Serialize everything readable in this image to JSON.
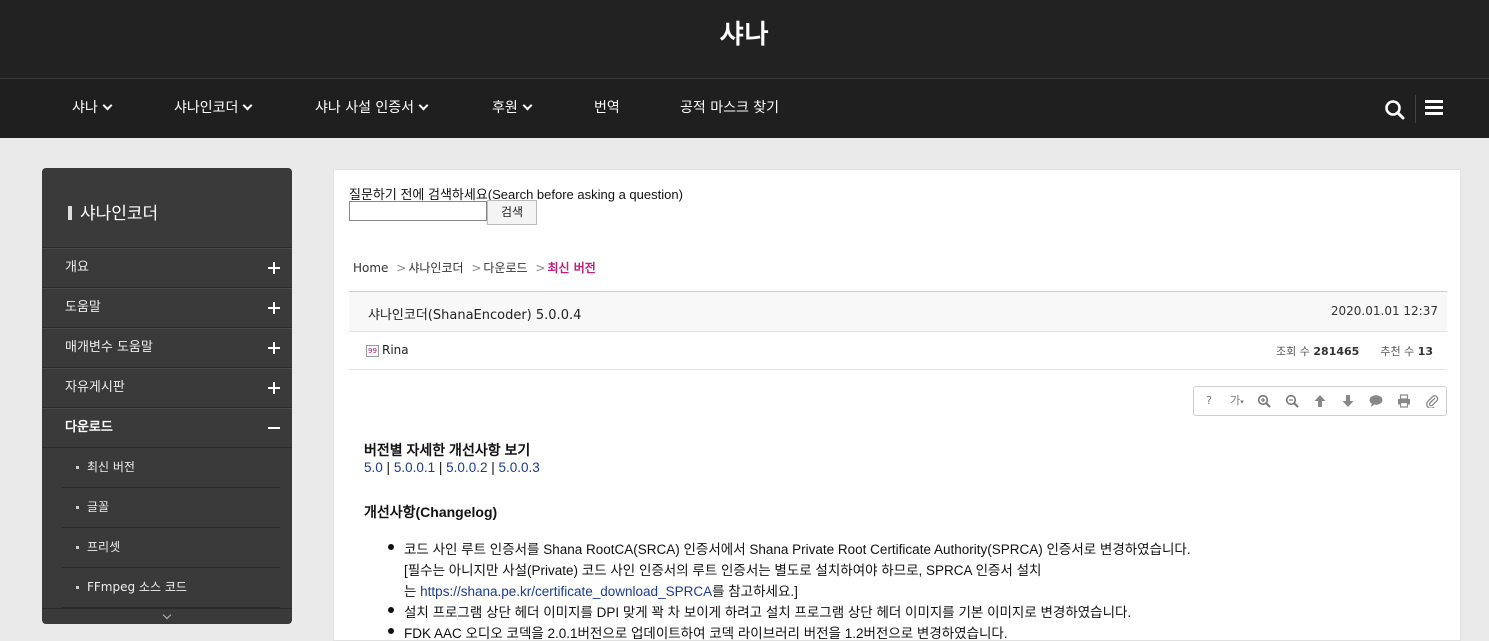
{
  "header": {
    "site_title": "샤나"
  },
  "nav": {
    "items": [
      {
        "label": "샤나",
        "dropdown": true
      },
      {
        "label": "샤나인코더",
        "dropdown": true
      },
      {
        "label": "샤나 사설 인증서",
        "dropdown": true
      },
      {
        "label": "후원",
        "dropdown": true
      },
      {
        "label": "번역",
        "dropdown": false
      },
      {
        "label": "공적 마스크 찾기",
        "dropdown": false
      }
    ],
    "search_icon": "search-icon",
    "menu_icon": "hamburger-menu-icon"
  },
  "sidebar": {
    "title": "샤나인코더",
    "items": [
      {
        "label": "개요",
        "expand": "plus"
      },
      {
        "label": "도움말",
        "expand": "plus"
      },
      {
        "label": "매개변수 도움말",
        "expand": "plus"
      },
      {
        "label": "자유게시판",
        "expand": "plus"
      },
      {
        "label": "다운로드",
        "expand": "minus",
        "active": true
      }
    ],
    "subitems": [
      {
        "label": "최신 버전"
      },
      {
        "label": "글꼴"
      },
      {
        "label": "프리셋"
      },
      {
        "label": "FFmpeg 소스 코드"
      }
    ]
  },
  "search": {
    "label": "질문하기 전에 검색하세요(Search before asking a question)",
    "value": "",
    "button": "검색"
  },
  "breadcrumb": {
    "items": [
      "Home",
      "샤나인코더",
      "다운로드"
    ],
    "current": "최신 버전"
  },
  "post": {
    "title": "샤나인코더(ShanaEncoder) 5.0.0.4",
    "date": "2020.01.01 12:37",
    "author": "Rina",
    "views_label": "조회 수",
    "views": "281465",
    "votes_label": "추천 수",
    "votes": "13"
  },
  "toolbar": {
    "icons": [
      "help-icon",
      "font-size-icon",
      "zoom-in-icon",
      "zoom-out-icon",
      "arrow-up-icon",
      "arrow-down-icon",
      "comment-icon",
      "print-icon",
      "attachment-icon"
    ],
    "help_label": "?",
    "font_label": "가"
  },
  "content": {
    "versions_heading": "버전별 자세한 개선사항 보기",
    "version_links": [
      "5.0",
      "5.0.0.1",
      "5.0.0.2",
      "5.0.0.3"
    ],
    "changelog_heading": "개선사항(Changelog)",
    "changelog": [
      {
        "lines": [
          "코드 사인 루트 인증서를 Shana RootCA(SRCA) 인증서에서 Shana Private Root Certificate Authority(SPRCA) 인증서로 변경하였습니다.",
          "[필수는 아니지만 사설(Private) 코드 사인 인증서의 루트 인증서는 별도로 설치하여야 하므로, SPRCA 인증서 설치"
        ],
        "line3_prefix": "는 ",
        "line3_link": "https://shana.pe.kr/certificate_download_SPRCA",
        "line3_suffix": "를 참고하세요.]"
      },
      {
        "text": "설치 프로그램 상단 헤더 이미지를 DPI 맞게 꽉 차 보이게 하려고 설치 프로그램 상단 헤더 이미지를 기본 이미지로 변경하였습니다."
      },
      {
        "text": "FDK AAC 오디오 코덱을 2.0.1버전으로 업데이트하여 코덱 라이브러리 버전을 1.2버전으로 변경하였습니다."
      }
    ]
  }
}
